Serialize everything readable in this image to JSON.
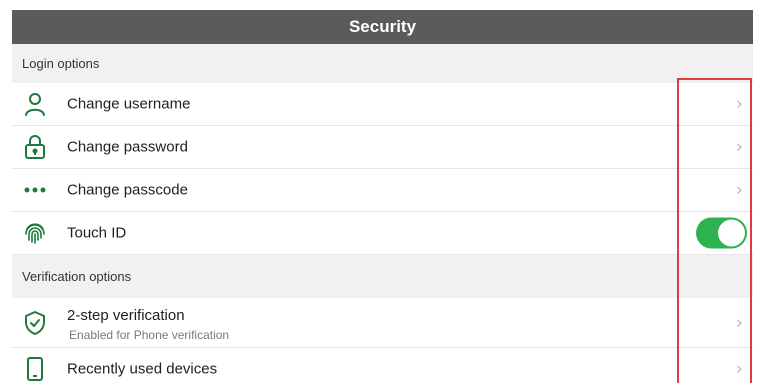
{
  "header": {
    "title": "Security"
  },
  "sections": {
    "login": {
      "label": "Login options"
    },
    "verification": {
      "label": "Verification options"
    }
  },
  "rows": {
    "change_username": {
      "label": "Change username",
      "icon": "user-icon"
    },
    "change_password": {
      "label": "Change password",
      "icon": "lock-icon"
    },
    "change_passcode": {
      "label": "Change passcode",
      "icon": "dots-icon"
    },
    "touch_id": {
      "label": "Touch ID",
      "icon": "fingerprint-icon",
      "enabled": true
    },
    "two_step": {
      "label": "2-step verification",
      "sublabel": "Enabled for Phone verification",
      "icon": "shield-check-icon"
    },
    "recent_devices": {
      "label": "Recently used devices",
      "icon": "phone-icon"
    }
  },
  "colors": {
    "accent": "#1e7a3c",
    "toggle_on": "#2eb24f",
    "header_bg": "#5b5b5b",
    "highlight": "#e03a3a"
  },
  "chevron_glyph": "›"
}
